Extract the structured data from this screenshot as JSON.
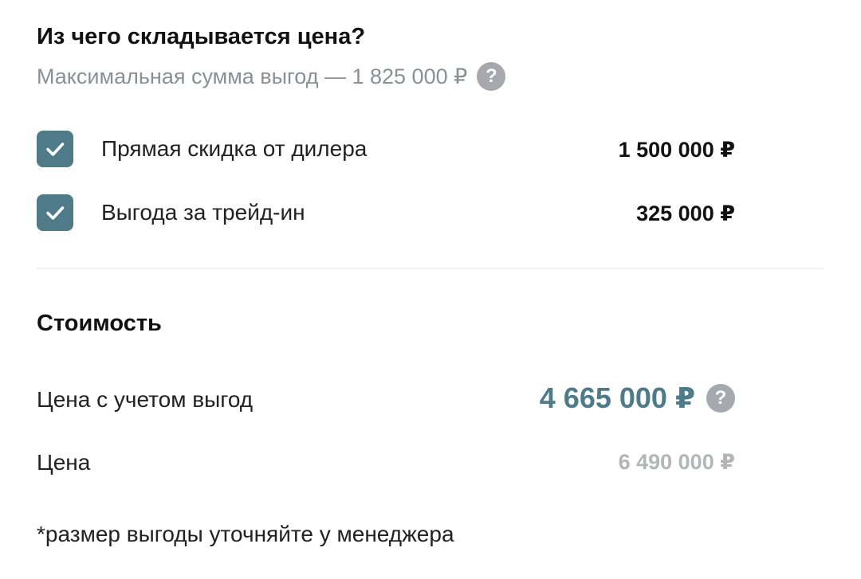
{
  "header": {
    "title": "Из чего складывается цена?",
    "subtitle": "Максимальная сумма выгод — 1 825 000 ₽",
    "help_glyph": "?"
  },
  "benefits": [
    {
      "label": "Прямая скидка от дилера",
      "amount": "1 500 000 ₽",
      "checked": true
    },
    {
      "label": "Выгода за трейд-ин",
      "amount": "325 000 ₽",
      "checked": true
    }
  ],
  "cost": {
    "title": "Стоимость",
    "final_label": "Цена с учетом выгод",
    "final_value": "4 665 000 ₽",
    "price_label": "Цена",
    "price_value": "6 490 000 ₽"
  },
  "footnote": "*размер выгоды уточняйте у менеджера",
  "colors": {
    "accent": "#4f7a87",
    "muted_text": "#8a8f93",
    "help_icon_bg": "#a5a9ad",
    "old_price": "#b3b6b9"
  },
  "icons": {
    "help": "question-circle-icon",
    "check": "checkmark-icon"
  }
}
